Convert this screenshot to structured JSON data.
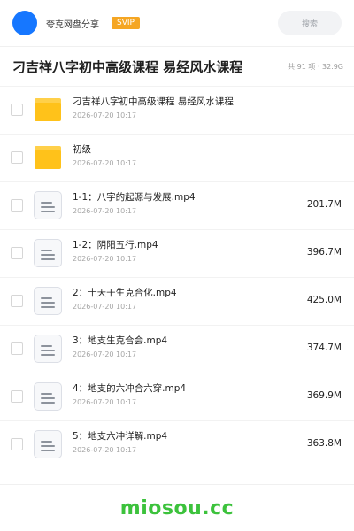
{
  "header": {
    "brand": "夸克网盘分享",
    "badge": "SVIP",
    "search_label": "搜索"
  },
  "share": {
    "title": "刁吉祥八字初中高级课程 易经风水课程",
    "meta": "共 91 项 · 32.9G"
  },
  "files": [
    {
      "type": "folder",
      "name": "刁吉祥八字初中高级课程 易经风水课程",
      "date": "2026-07-20 10:17",
      "size": ""
    },
    {
      "type": "folder",
      "name": "初级",
      "date": "2026-07-20 10:17",
      "size": ""
    },
    {
      "type": "file",
      "name": "1-1：八字的起源与发展.mp4",
      "date": "2026-07-20 10:17",
      "size": "201.7M"
    },
    {
      "type": "file",
      "name": "1-2：阴阳五行.mp4",
      "date": "2026-07-20 10:17",
      "size": "396.7M"
    },
    {
      "type": "file",
      "name": "2：十天干生克合化.mp4",
      "date": "2026-07-20 10:17",
      "size": "425.0M"
    },
    {
      "type": "file",
      "name": "3：地支生克合会.mp4",
      "date": "2026-07-20 10:17",
      "size": "374.7M"
    },
    {
      "type": "file",
      "name": "4：地支的六冲合六穿.mp4",
      "date": "2026-07-20 10:17",
      "size": "369.9M"
    },
    {
      "type": "file",
      "name": "5：地支六冲详解.mp4",
      "date": "2026-07-20 10:17",
      "size": "363.8M"
    }
  ],
  "watermark": "miosou.cc",
  "icons": {
    "folder": "folder-icon",
    "file": "video-file-icon",
    "avatar": "avatar"
  },
  "colors": {
    "accent": "#1677ff",
    "svip": "#f5a623",
    "folder": "#ffc21a",
    "watermark": "#3cc23c"
  }
}
